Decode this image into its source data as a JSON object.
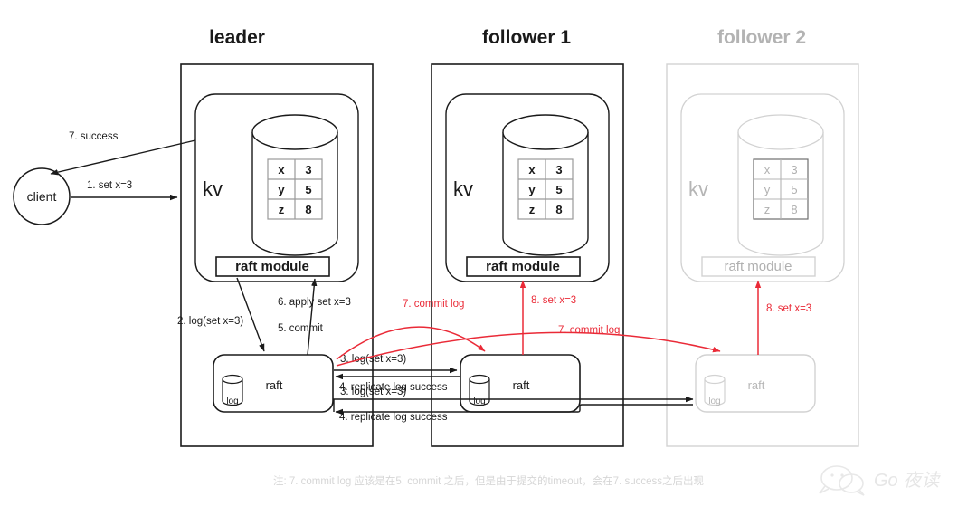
{
  "diagram": {
    "title_hidden": "",
    "nodes": [
      {
        "id": "leader",
        "title": "leader",
        "kv_label": "kv",
        "raft_module_label": "raft module",
        "raft_label": "raft",
        "log_label": "log",
        "dim": false,
        "store_rows": [
          {
            "key": "x",
            "value": "3"
          },
          {
            "key": "y",
            "value": "5"
          },
          {
            "key": "z",
            "value": "8"
          }
        ]
      },
      {
        "id": "follower1",
        "title": "follower 1",
        "kv_label": "kv",
        "raft_module_label": "raft module",
        "raft_label": "raft",
        "log_label": "log",
        "dim": false,
        "store_rows": [
          {
            "key": "x",
            "value": "3"
          },
          {
            "key": "y",
            "value": "5"
          },
          {
            "key": "z",
            "value": "8"
          }
        ]
      },
      {
        "id": "follower2",
        "title": "follower 2",
        "kv_label": "kv",
        "raft_module_label": "raft module",
        "raft_label": "raft",
        "log_label": "log",
        "dim": true,
        "store_rows": [
          {
            "key": "x",
            "value": "3"
          },
          {
            "key": "y",
            "value": "5"
          },
          {
            "key": "z",
            "value": "8"
          }
        ]
      }
    ],
    "client": {
      "label": "client"
    },
    "edges": [
      {
        "id": "e1",
        "label": "1.  set x=3",
        "color": "black"
      },
      {
        "id": "e7s",
        "label": "7.  success",
        "color": "black"
      },
      {
        "id": "e2",
        "label": "2. log(set x=3)",
        "color": "black"
      },
      {
        "id": "e5",
        "label": "5.  commit",
        "color": "black"
      },
      {
        "id": "e6",
        "label": "6. apply set x=3",
        "color": "black"
      },
      {
        "id": "e3a",
        "label": "3. log(set x=3)",
        "color": "black"
      },
      {
        "id": "e4a",
        "label": "4. replicate log success",
        "color": "black"
      },
      {
        "id": "e3b",
        "label": "3. log(set x=3)",
        "color": "black"
      },
      {
        "id": "e4b",
        "label": "4. replicate log success",
        "color": "black"
      },
      {
        "id": "e7a",
        "label": "7.  commit log",
        "color": "red"
      },
      {
        "id": "e7b",
        "label": "7.  commit log",
        "color": "red"
      },
      {
        "id": "e8a",
        "label": "8.  set x=3",
        "color": "red"
      },
      {
        "id": "e8b",
        "label": "8.  set x=3",
        "color": "red"
      }
    ],
    "footnote": "注: 7. commit log 应该是在5. commit 之后，但是由于提交的timeout，会在7. success之后出现",
    "watermark": {
      "text": "Go 夜读"
    },
    "colors": {
      "accent_red": "#ea2a37",
      "ink": "#1a1a1a",
      "dim": "#d2d2d2",
      "footnote": "#d6d6d6"
    }
  }
}
